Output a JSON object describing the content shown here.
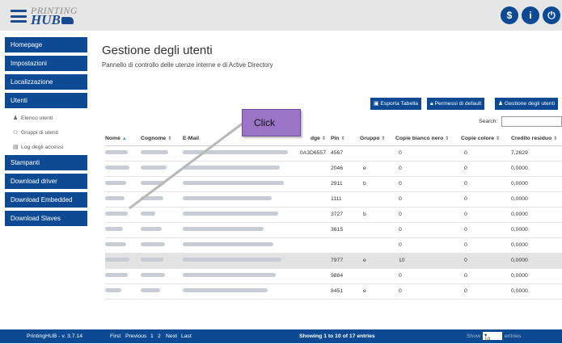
{
  "header": {
    "logo_line1": "PRINTING",
    "logo_line2": "HUB",
    "buttons": [
      {
        "symbol": "$",
        "name": "dollar-button"
      },
      {
        "symbol": "i",
        "name": "info-button"
      },
      {
        "symbol": "⏻",
        "name": "power-button"
      }
    ]
  },
  "sidebar": {
    "items": [
      {
        "label": "Homepage"
      },
      {
        "label": "Impostazioni"
      },
      {
        "label": "Localizzazione"
      },
      {
        "label": "Utenti"
      },
      {
        "label": "Elenco utenti",
        "sub": true,
        "icon": "user-icon",
        "glyph": "♟"
      },
      {
        "label": "Gruppi di utenti",
        "sub": true,
        "icon": "group-icon",
        "glyph": "⚇"
      },
      {
        "label": "Log degli accessi",
        "sub": true,
        "icon": "log-icon",
        "glyph": "▤"
      },
      {
        "label": "Stampanti"
      },
      {
        "label": "Download driver"
      },
      {
        "label": "Download Embedded"
      },
      {
        "label": "Download Slaves"
      }
    ]
  },
  "main": {
    "title": "Gestione degli utenti",
    "subtitle": "Pannello di controllo delle utenze interne e di Active Directory",
    "actions": {
      "export": "Esporta Tabella",
      "permissions": "Permessi di default",
      "manage": "Gestione degli utenti"
    },
    "search_label": "Search:",
    "search_value": "",
    "overlay_label": "Click"
  },
  "table": {
    "headers": [
      "Nome",
      "Cognome",
      "E-Mail",
      "dge",
      "Pin",
      "Gruppo",
      "Copie bianco nero",
      "Copie colore",
      "Credito residuo"
    ],
    "rows": [
      {
        "badge": "0A3D6557",
        "pin": "4567",
        "gruppo": "",
        "bn": "0",
        "colore": "0",
        "credito": "7,2629",
        "blur": [
          28,
          34,
          130
        ]
      },
      {
        "badge": "",
        "pin": "2046",
        "gruppo": "e",
        "bn": "0",
        "colore": "0",
        "credito": "0,0000",
        "blur": [
          30,
          32,
          120
        ]
      },
      {
        "badge": "",
        "pin": "2911",
        "gruppo": "b",
        "bn": "0",
        "colore": "0",
        "credito": "0,0000",
        "blur": [
          26,
          30,
          125
        ]
      },
      {
        "badge": "",
        "pin": "1111",
        "gruppo": "",
        "bn": "0",
        "colore": "0",
        "credito": "0,0000",
        "blur": [
          24,
          28,
          110
        ]
      },
      {
        "badge": "",
        "pin": "3727",
        "gruppo": "b",
        "bn": "0",
        "colore": "0",
        "credito": "0,0000",
        "blur": [
          28,
          18,
          118
        ]
      },
      {
        "badge": "",
        "pin": "3615",
        "gruppo": "",
        "bn": "0",
        "colore": "0",
        "credito": "0,0000",
        "blur": [
          22,
          26,
          100
        ]
      },
      {
        "badge": "",
        "pin": "",
        "gruppo": "",
        "bn": "0",
        "colore": "0",
        "credito": "0,0000",
        "blur": [
          26,
          30,
          112
        ]
      },
      {
        "badge": "",
        "pin": "7977",
        "gruppo": "e",
        "bn": "10",
        "colore": "0",
        "credito": "0,0000",
        "blur": [
          30,
          28,
          122
        ],
        "highlight": true
      },
      {
        "badge": "",
        "pin": "9884",
        "gruppo": "",
        "bn": "0",
        "colore": "0",
        "credito": "0,0000",
        "blur": [
          28,
          30,
          115
        ]
      },
      {
        "badge": "",
        "pin": "8451",
        "gruppo": "e",
        "bn": "0",
        "colore": "0",
        "credito": "0,0000",
        "blur": [
          20,
          24,
          105
        ]
      }
    ]
  },
  "footer": {
    "version": "PrintingHUB - v. 3.7.14",
    "pager": [
      "First",
      "Previous",
      "1",
      "2",
      "Next",
      "Last"
    ],
    "showing": "Showing 1 to 10 of 17 entries",
    "show_label": "Show",
    "show_value": "10",
    "entries_label": "entries"
  },
  "colors": {
    "primary": "#0d4a93",
    "topbar": "#e6e6e6",
    "overlay": "#9b74c8"
  }
}
